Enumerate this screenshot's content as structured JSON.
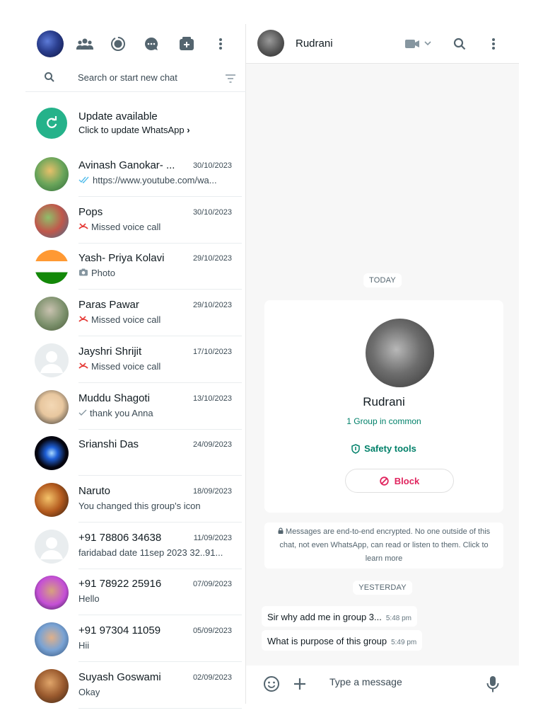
{
  "left": {
    "search_placeholder": "Search or start new chat",
    "update": {
      "title": "Update available",
      "subtitle": "Click to update WhatsApp",
      "chevron": "›"
    },
    "chats": [
      {
        "name": "Avinash Ganokar- ...",
        "date": "30/10/2023",
        "preview": "https://www.youtube.com/wa...",
        "status": "double-tick"
      },
      {
        "name": "Pops",
        "date": "30/10/2023",
        "preview": "Missed voice call",
        "status": "missed-call"
      },
      {
        "name": "Yash- Priya Kolavi",
        "date": "29/10/2023",
        "preview": "Photo",
        "status": "camera"
      },
      {
        "name": "Paras Pawar",
        "date": "29/10/2023",
        "preview": "Missed voice call",
        "status": "missed-call"
      },
      {
        "name": "Jayshri Shrijit",
        "date": "17/10/2023",
        "preview": "Missed voice call",
        "status": "missed-call"
      },
      {
        "name": "Muddu Shagoti",
        "date": "13/10/2023",
        "preview": "thank you Anna",
        "status": "single-tick"
      },
      {
        "name": "Srianshi Das",
        "date": "24/09/2023",
        "preview": "",
        "status": "none"
      },
      {
        "name": "Naruto",
        "date": "18/09/2023",
        "preview": "You changed this group's icon",
        "status": "none"
      },
      {
        "name": "+91 78806 34638",
        "date": "11/09/2023",
        "preview": "faridabad date 11sep 2023 32..91...",
        "status": "none"
      },
      {
        "name": "+91 78922 25916",
        "date": "07/09/2023",
        "preview": "Hello",
        "status": "none"
      },
      {
        "name": "+91 97304 11059",
        "date": "05/09/2023",
        "preview": "Hii",
        "status": "none"
      },
      {
        "name": "Suyash Goswami",
        "date": "02/09/2023",
        "preview": "Okay",
        "status": "none"
      }
    ]
  },
  "conversation": {
    "contact_name": "Rudrani",
    "today_label": "TODAY",
    "yesterday_label": "YESTERDAY",
    "profile": {
      "name": "Rudrani",
      "groups_common": "1 Group in common",
      "safety_tools": "Safety tools",
      "block": "Block"
    },
    "encryption_notice": "Messages are end-to-end encrypted. No one outside of this chat, not even WhatsApp, can read or listen to them. Click to learn more",
    "messages": [
      {
        "text": "Sir why add me in group 3...",
        "time": "5:48 pm"
      },
      {
        "text": "What is purpose of this group",
        "time": "5:49 pm"
      }
    ],
    "composer_placeholder": "Type a message"
  },
  "colors": {
    "accent_green": "#008069",
    "update_green": "#25b28a",
    "block_red": "#e0245e",
    "missed_call_red": "#e53935",
    "tick_blue": "#53bdeb"
  }
}
